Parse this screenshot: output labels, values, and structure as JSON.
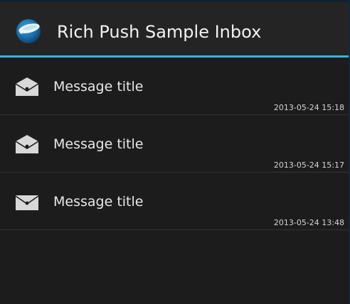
{
  "app": {
    "title": "Rich Push Sample Inbox",
    "logo_icon": "airship-logo-icon"
  },
  "colors": {
    "accent": "#33b5e5",
    "background": "#1c1c1c",
    "actionbar": "#242424",
    "divider": "#343434",
    "text": "#e8e8e8"
  },
  "messages": [
    {
      "title": "Message title",
      "timestamp": "2013-05-24 15:18",
      "icon": "envelope-open-icon",
      "read": true
    },
    {
      "title": "Message title",
      "timestamp": "2013-05-24 15:17",
      "icon": "envelope-open-icon",
      "read": true
    },
    {
      "title": "Message title",
      "timestamp": "2013-05-24 13:48",
      "icon": "envelope-closed-icon",
      "read": false
    }
  ]
}
